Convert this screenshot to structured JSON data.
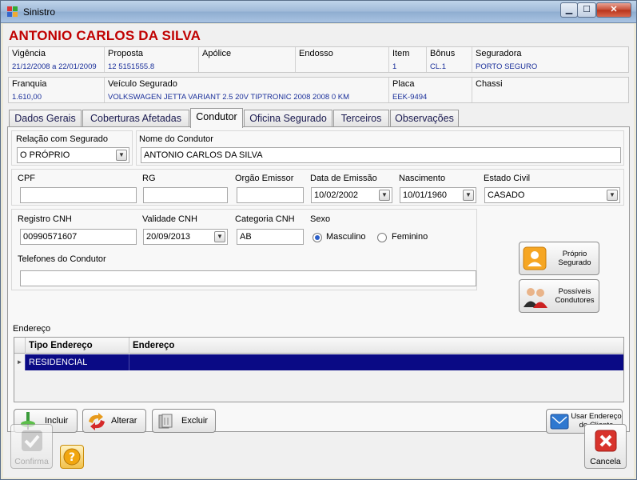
{
  "window": {
    "title": "Sinistro"
  },
  "holder": {
    "name": "ANTONIO CARLOS DA SILVA"
  },
  "policy": {
    "vigencia": {
      "label": "Vigência",
      "value": "21/12/2008 a 22/01/2009"
    },
    "proposta": {
      "label": "Proposta",
      "value": "12 5151555.8"
    },
    "apolice": {
      "label": "Apólice",
      "value": ""
    },
    "endosso": {
      "label": "Endosso",
      "value": ""
    },
    "item": {
      "label": "Item",
      "value": "1"
    },
    "bonus": {
      "label": "Bônus",
      "value": "CL.1"
    },
    "seguradora": {
      "label": "Seguradora",
      "value": "PORTO SEGURO"
    },
    "franquia": {
      "label": "Franquia",
      "value": "1.610,00"
    },
    "veiculo": {
      "label": "Veículo Segurado",
      "value": "VOLKSWAGEN JETTA VARIANT 2.5 20V TIPTRONIC 2008 2008 0 KM"
    },
    "placa": {
      "label": "Placa",
      "value": "EEK-9494"
    },
    "chassi": {
      "label": "Chassi",
      "value": ""
    }
  },
  "tabs": [
    {
      "label": "Dados Gerais"
    },
    {
      "label": "Coberturas Afetadas"
    },
    {
      "label": "Condutor"
    },
    {
      "label": "Oficina Segurado"
    },
    {
      "label": "Terceiros"
    },
    {
      "label": "Observações"
    }
  ],
  "form": {
    "relacao": {
      "label": "Relação com Segurado",
      "value": "O PRÓPRIO"
    },
    "nome": {
      "label": "Nome do Condutor",
      "value": "ANTONIO CARLOS DA SILVA"
    },
    "cpf": {
      "label": "CPF",
      "value": ""
    },
    "rg": {
      "label": "RG",
      "value": ""
    },
    "orgao": {
      "label": "Orgão Emissor",
      "value": ""
    },
    "emissao": {
      "label": "Data de Emissão",
      "value": "10/02/2002"
    },
    "nascimento": {
      "label": "Nascimento",
      "value": "10/01/1960"
    },
    "estado_civil": {
      "label": "Estado Civil",
      "value": "CASADO"
    },
    "registro_cnh": {
      "label": "Registro CNH",
      "value": "00990571607"
    },
    "validade_cnh": {
      "label": "Validade CNH",
      "value": "20/09/2013"
    },
    "categoria_cnh": {
      "label": "Categoria CNH",
      "value": "AB"
    },
    "sexo": {
      "label": "Sexo",
      "options": [
        "Masculino",
        "Feminino"
      ],
      "selected": "Masculino"
    },
    "telefones": {
      "label": "Telefones do Condutor",
      "value": ""
    }
  },
  "side_buttons": {
    "proprio": "Próprio\nSegurado",
    "possiveis": "Possíveis\nCondutores"
  },
  "address": {
    "label": "Endereço",
    "columns": [
      "Tipo Endereço",
      "Endereço"
    ],
    "rows": [
      {
        "tipo": "RESIDENCIAL",
        "endereco": ""
      }
    ]
  },
  "toolbar": {
    "incluir": "Incluir",
    "alterar": "Alterar",
    "excluir": "Excluir",
    "usar_endereco": "Usar Endereço\ndo Cliente"
  },
  "footer": {
    "confirma": "Confirma",
    "cancela": "Cancela"
  },
  "colors": {
    "accent_red": "#c00000",
    "value_blue": "#1a2f9a",
    "selected_row": "#0a0a85"
  }
}
